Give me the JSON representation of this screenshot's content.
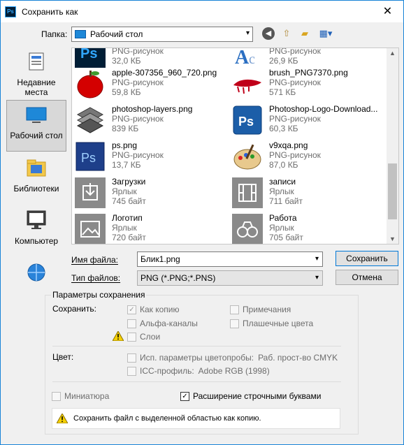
{
  "window": {
    "title": "Сохранить как",
    "close_glyph": "✕"
  },
  "location": {
    "label": "Папка:",
    "value": "Рабочий стол"
  },
  "places": [
    {
      "label_line1": "Недавние",
      "label_line2": "места",
      "icon": "recent-places-icon"
    },
    {
      "label_line1": "Рабочий стол",
      "label_line2": "",
      "icon": "desktop-icon"
    },
    {
      "label_line1": "Библиотеки",
      "label_line2": "",
      "icon": "libraries-icon"
    },
    {
      "label_line1": "Компьютер",
      "label_line2": "",
      "icon": "computer-icon"
    },
    {
      "label_line1": "",
      "label_line2": "",
      "icon": "network-icon"
    }
  ],
  "files": [
    {
      "name": "",
      "type": "PNG-рисунок",
      "size": "32,0 КБ",
      "icon": "ps-thumb"
    },
    {
      "name": "",
      "type": "PNG-рисунок",
      "size": "26,9 КБ",
      "icon": "logo-thumb"
    },
    {
      "name": "apple-307356_960_720.png",
      "type": "PNG-рисунок",
      "size": "59,8 КБ",
      "icon": "apple-thumb"
    },
    {
      "name": "brush_PNG7370.png",
      "type": "PNG-рисунок",
      "size": "571 КБ",
      "icon": "brush-thumb"
    },
    {
      "name": "photoshop-layers.png",
      "type": "PNG-рисунок",
      "size": "839 КБ",
      "icon": "layers-thumb"
    },
    {
      "name": "Photoshop-Logo-Download...",
      "type": "PNG-рисунок",
      "size": "60,3 КБ",
      "icon": "ps-logo-thumb"
    },
    {
      "name": "ps.png",
      "type": "PNG-рисунок",
      "size": "13,7 КБ",
      "icon": "ps-thumb"
    },
    {
      "name": "v9xqa.png",
      "type": "PNG-рисунок",
      "size": "87,0 КБ",
      "icon": "palette-thumb"
    },
    {
      "name": "Загрузки",
      "type": "Ярлык",
      "size": "745 байт",
      "icon": "downloads-shortcut-icon"
    },
    {
      "name": "записи",
      "type": "Ярлык",
      "size": "711 байт",
      "icon": "video-shortcut-icon"
    },
    {
      "name": "Логотип",
      "type": "Ярлык",
      "size": "720 байт",
      "icon": "image-shortcut-icon"
    },
    {
      "name": "Работа",
      "type": "Ярлык",
      "size": "705 байт",
      "icon": "binoculars-shortcut-icon"
    }
  ],
  "filename": {
    "label": "Имя файла:",
    "value": "Блик1.png"
  },
  "filetype": {
    "label": "Тип файлов:",
    "value": "PNG (*.PNG;*.PNS)"
  },
  "buttons": {
    "save": "Сохранить",
    "cancel": "Отмена"
  },
  "options": {
    "group_title": "Параметры сохранения",
    "save_label": "Сохранить:",
    "as_copy": "Как копию",
    "notes": "Примечания",
    "alpha": "Альфа-каналы",
    "spot": "Плашечные цвета",
    "layers": "Слои",
    "color_label": "Цвет:",
    "proof": "Исп. параметры цветопробы:",
    "proof_value": "Раб. прост-во CMYK",
    "icc": "ICC-профиль:",
    "icc_value": "Adobe RGB (1998)",
    "thumbnail": "Миниатюра",
    "lowercase_ext": "Расширение строчными буквами",
    "message": "Сохранить файл с выделенной областью как копию."
  },
  "colors": {
    "accent": "#0078d7",
    "selected_place": "#d8d8d8"
  }
}
